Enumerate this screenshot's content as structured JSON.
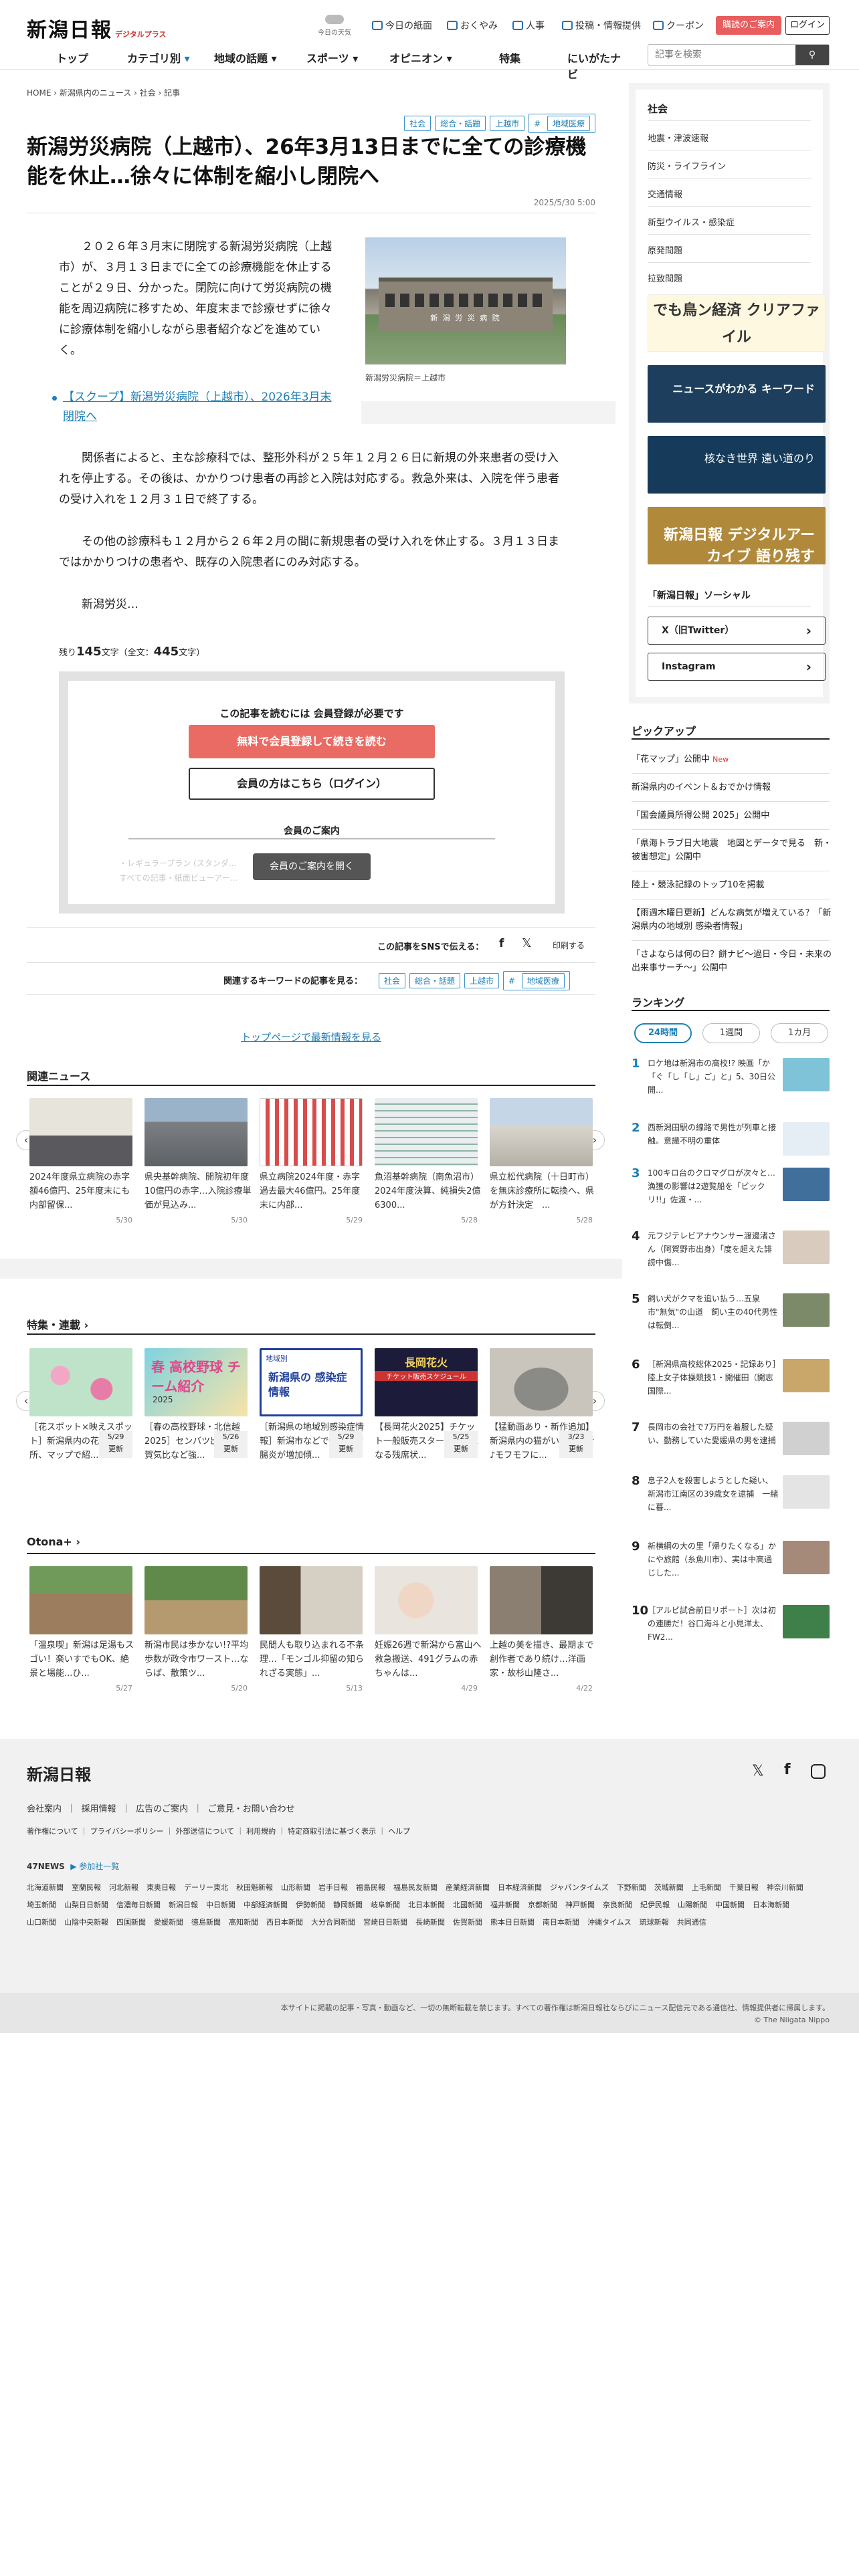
{
  "header": {
    "logo": "新潟日報",
    "logo_sub": "デジタルプラス",
    "weather": "今日の天気",
    "util": [
      "今日の紙面",
      "おくやみ",
      "人事",
      "投稿・情報提供",
      "クーポン"
    ],
    "register": "購読のご案内",
    "login": "ログイン",
    "nav": [
      "トップ",
      "カテゴリ別",
      "地域の話題",
      "スポーツ",
      "オピニオン",
      "特集",
      "にいがたナビ"
    ],
    "search_placeholder": "記事を検索"
  },
  "breadcrumb": [
    "HOME",
    "新潟県内のニュース",
    "社会",
    "記事"
  ],
  "article": {
    "tags": [
      "社会",
      "総合・話題",
      "上越市",
      "地域医療"
    ],
    "title": "新潟労災病院（上越市）、26年3月13日までに全ての診療機能を休止…徐々に体制を縮小し閉院へ",
    "date": "2025/5/30 5:00",
    "p1": "２０２６年３月末に閉院する新潟労災病院（上越市）が、３月１３日までに全ての診療機能を休止することが２９日、分かった。閉院に向けて労災病院の機能を周辺病院に移すため、年度末まで診療せずに徐々に診療体制を縮小しながら患者紹介などを進めていく。",
    "caption": "新潟労災病院＝上越市",
    "photo_sign": "新 潟 労 災 病 院",
    "scoop": "【スクープ】新潟労災病院（上越市）、2026年3月末閉院へ",
    "p2": "関係者によると、主な診療科では、整形外科が２５年１２月２６日に新規の外来患者の受け入れを停止する。その後は、かかりつけ患者の再診と入院は対応する。救急外来は、入院を伴う患者の受け入れを１２月３１日で終了する。",
    "p3": "その他の診療科も１２月から２６年２月の間に新規患者の受け入れを休止する。３月１３日まではかかりつけの患者や、既存の入院患者にのみ対応する。",
    "p4": "新潟労災…",
    "remaining_pre": "残り",
    "remaining": "145",
    "remaining_mid": "文字（全文：",
    "total": "445",
    "remaining_post": "文字）"
  },
  "paywall": {
    "title": "この記事を読むには 会員登録が必要です",
    "register": "無料で会員登録して続きを読む",
    "login": "会員の方はこちら（ログイン）",
    "guide": "会員のご案内",
    "blur1": "・レギュラープラン (スタンダ...",
    "blur2": "すべての記事・紙面ビューアー...",
    "open": "会員のご案内を開く"
  },
  "share": {
    "label": "この記事をSNSで伝える：",
    "print": "印刷する"
  },
  "keywords": {
    "label": "関連するキーワードの記事を見る：",
    "tags": [
      "社会",
      "総合・話題",
      "上越市",
      "地域医療"
    ]
  },
  "top_link": "トップページで最新情報を見る",
  "related": {
    "title": "関連ニュース",
    "items": [
      {
        "text": "2024年度県立病院の赤字額46億円、25年度末にも内部留保...",
        "date": "5/30"
      },
      {
        "text": "県央基幹病院、開院初年度10億円の赤字…入院診療単価が見込み...",
        "date": "5/30"
      },
      {
        "text": "県立病院2024年度・赤字過去最大46億円。25年度末に内部...",
        "date": "5/29"
      },
      {
        "text": "魚沼基幹病院（南魚沼市）2024年度決算、純損失2億6300...",
        "date": "5/28"
      },
      {
        "text": "県立松代病院（十日町市）を無床診療所に転換へ、県が方針決定　...",
        "date": "5/28"
      }
    ]
  },
  "features": {
    "title": "特集・連載 ›",
    "items": [
      {
        "text": "［花スポット×映えスポット］新潟県内の花畑や名所、マップで紹...",
        "date": "5/29",
        "badge": "更新"
      },
      {
        "text": "［春の高校野球・北信越2025］センバツ出場の敦賀気比など強...",
        "date": "5/26",
        "badge": "更新"
      },
      {
        "text": "［新潟県の地域別感染症情報］新潟市などで感染性胃腸炎が増加傾...",
        "date": "5/29",
        "badge": "更新"
      },
      {
        "text": "【長岡花火2025】チケット一般販売スタート！気になる残席状...",
        "date": "5/25",
        "badge": "更新"
      },
      {
        "text": "【猛動画あり・新作追加】新潟県内の猫がいる店紹介♪モフモフに...",
        "date": "3/23",
        "badge": "更新"
      }
    ]
  },
  "feature_banner_labels": {
    "spring": "春 高校野球 チーム紹介",
    "spring_year": "2025",
    "infection": "新潟県の 感染症情報",
    "region": "地域別",
    "hanabi": "長岡花火",
    "hanabi_sub": "チケット販売スケジュール"
  },
  "otona": {
    "title": "Otona+ ›",
    "items": [
      {
        "text": "「温泉喫」新潟は足湯もスゴい！楽いすでもOK、絶景と場能...ひ...",
        "date": "5/27"
      },
      {
        "text": "新潟市民は歩かない!?平均歩数が政令市ワースト…ならば、散策ツ...",
        "date": "5/20"
      },
      {
        "text": "民間人も取り込まれる不条理…「モンゴル抑留の知られざる実態」...",
        "date": "5/13"
      },
      {
        "text": "妊娠26週で新潟から富山へ救急搬送、491グラムの赤ちゃんは...",
        "date": "4/29"
      },
      {
        "text": "上越の美を描き、最期まで創作者であり続け…洋画家・故杉山隆さ...",
        "date": "4/22"
      }
    ]
  },
  "sidebar": {
    "head": "社会",
    "items": [
      "地震・津波速報",
      "防災・ライフライン",
      "交通情報",
      "新型ウイルス・感染症",
      "原発問題",
      "拉致問題"
    ],
    "banners": [
      "でも鳥ン経済 クリアファイル",
      "ニュースがわかる キーワード",
      "核なき世界 遠い道のり",
      "新潟日報 デジタルアーカイブ 語り残す"
    ],
    "social_title": "「新潟日報」ソーシャル",
    "social": [
      "X（旧Twitter）",
      "Instagram"
    ]
  },
  "pickup": {
    "title": "ピックアップ",
    "items": [
      "「花マップ」公開中",
      "新潟県内のイベント＆おでかけ情報",
      "「国会議員所得公開 2025」公開中",
      "「県海トラブ日大地震　地図とデータで見る　新・被害想定」公開中",
      "陸上・競泳記録のトップ10を掲載",
      "【雨週木曜日更新】どんな病気が増えている？「新潟県内の地域別 感染者情報」",
      "「さよならは何の日？餅ナビ～過日・今日・未来の出来事サーチ～」公開中"
    ],
    "new": "New"
  },
  "ranking": {
    "title": "ランキング",
    "tabs": [
      "24時間",
      "1週間",
      "1カ月"
    ],
    "items": [
      "ロケ地は新潟市の高校!? 映画「か「ぐ「し「し」ご」と」5、30日公開...",
      "西新潟田駅の線路で男性が列車と接触。意識不明の重体",
      "100キロ台のクロマグロが次々と…漁獲の影響は2遊覧船を「ビックリ!!」佐渡・...",
      "元フジテレビアナウンサー渡邊渚さん（阿賀野市出身）「度を超えた誹謗中傷...",
      "飼い犬がクマを追い払う…五泉市\"無気\"の山道　飼い主の40代男性は転倒...",
      "［新潟県高校総体2025・記録あり］陸上女子体操競技1・開催田（開志国際...",
      "長岡市の会社で7万円を着服した疑い、勤務していた愛媛県の男を逮捕",
      "息子2人を殺害しようとした疑い、新潟市江南区の39歳女を逮捕　一緒に暮...",
      "新横綱の大の里「帰りたくなる」かにや旅館（糸魚川市）、実は中高通じした...",
      "［アルビ試合前日リポート］次は初の連勝だ！谷口海斗と小見洋太、FW2..."
    ]
  },
  "footer": {
    "logo": "新潟日報",
    "links1": [
      "会社案内",
      "採用情報",
      "広告のご案内",
      "ご意見・お問い合わせ"
    ],
    "links2": [
      "著作権について",
      "プライバシーポリシー",
      "外部送信について",
      "利用規約",
      "特定商取引法に基づく表示",
      "ヘルプ"
    ],
    "news47": "47NEWS",
    "members": "参加社一覧",
    "papers": [
      "北海道新聞",
      "室蘭民報",
      "河北新報",
      "東奥日報",
      "デーリー東北",
      "秋田魁新報",
      "山形新聞",
      "岩手日報",
      "福島民報",
      "福島民友新聞",
      "産業経済新聞",
      "日本経済新聞",
      "ジャパンタイムズ",
      "下野新聞",
      "茨城新聞",
      "上毛新聞",
      "千葉日報",
      "神奈川新聞",
      "埼玉新聞",
      "山梨日日新聞",
      "信濃毎日新聞",
      "新潟日報",
      "中日新聞",
      "中部経済新聞",
      "伊勢新聞",
      "静岡新聞",
      "岐阜新聞",
      "北日本新聞",
      "北國新聞",
      "福井新聞",
      "京都新聞",
      "神戸新聞",
      "奈良新聞",
      "紀伊民報",
      "山陽新聞",
      "中国新聞",
      "日本海新聞",
      "山口新聞",
      "山陰中央新報",
      "四国新聞",
      "愛媛新聞",
      "徳島新聞",
      "高知新聞",
      "西日本新聞",
      "大分合同新聞",
      "宮崎日日新聞",
      "長崎新聞",
      "佐賀新聞",
      "熊本日日新聞",
      "南日本新聞",
      "沖縄タイムス",
      "琉球新報",
      "共同通信"
    ],
    "notice": "本サイトに掲載の記事・写真・動画など、一切の無断転載を禁じます。すべての著作権は新潟日報社ならびにニュース配信元である通信社、情報提供者に帰属します。",
    "copyright": "© The Niigata Nippo"
  }
}
